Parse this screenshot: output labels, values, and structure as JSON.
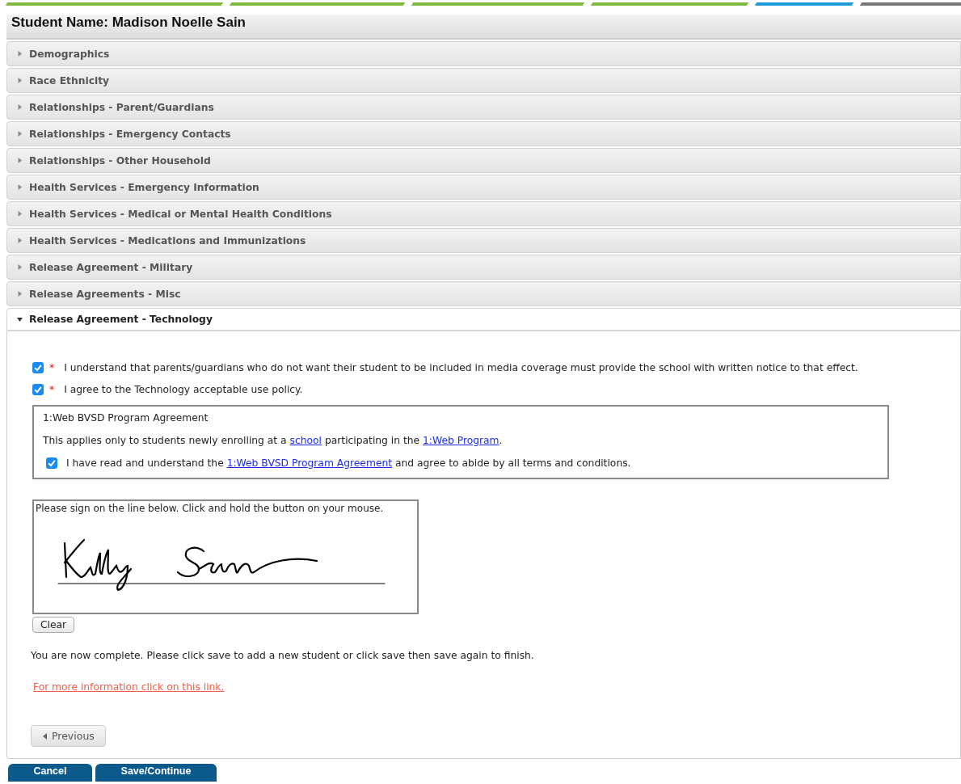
{
  "steps": [
    {
      "color": "#7dbb42"
    },
    {
      "color": "#7dbb42"
    },
    {
      "color": "#7dbb42"
    },
    {
      "color": "#7dbb42"
    },
    {
      "color": "#1e9ad6"
    },
    {
      "color": "#777777"
    }
  ],
  "title": "Student Name: Madison Noelle Sain",
  "sections": [
    {
      "title": "Demographics",
      "expanded": false
    },
    {
      "title": "Race Ethnicity",
      "expanded": false
    },
    {
      "title": "Relationships - Parent/Guardians",
      "expanded": false
    },
    {
      "title": "Relationships - Emergency Contacts",
      "expanded": false
    },
    {
      "title": "Relationships - Other Household",
      "expanded": false
    },
    {
      "title": "Health Services - Emergency Information",
      "expanded": false
    },
    {
      "title": "Health Services - Medical or Mental Health Conditions",
      "expanded": false
    },
    {
      "title": "Health Services - Medications and Immunizations",
      "expanded": false
    },
    {
      "title": "Release Agreement - Military",
      "expanded": false
    },
    {
      "title": "Release Agreements - Misc",
      "expanded": false
    },
    {
      "title": "Release Agreement - Technology",
      "expanded": true
    }
  ],
  "agreements": [
    {
      "checked": true,
      "required_mark": "*",
      "text": "I understand that parents/guardians who do not want their student to be included in media coverage must provide the school with written notice to that effect."
    },
    {
      "checked": true,
      "required_mark": "*",
      "text": "I agree to the Technology acceptable use policy."
    }
  ],
  "program_box": {
    "title": "1:Web BVSD Program Agreement",
    "note": [
      {
        "kind": "text",
        "text": "This applies only to students newly enrolling at a "
      },
      {
        "kind": "link",
        "text": "school"
      },
      {
        "kind": "text",
        "text": " participating in the "
      },
      {
        "kind": "link",
        "text": "1:Web Program"
      },
      {
        "kind": "text",
        "text": "."
      }
    ],
    "agreement": {
      "checked": true,
      "parts": [
        {
          "kind": "text",
          "text": "I have read and understand the "
        },
        {
          "kind": "link",
          "text": "1:Web BVSD Program Agreement"
        },
        {
          "kind": "text",
          "text": " and agree to abide by all terms and conditions."
        }
      ]
    }
  },
  "signature": {
    "prompt": "Please sign on the line below. Click and hold the button on your mouse.",
    "clear_button": "Clear"
  },
  "completion_text": "You are now complete. Please click save to add a new student or click save then save again to finish.",
  "info_link": "For more information click on this link.",
  "previous_button": "Previous",
  "footer_buttons": [
    "Cancel",
    "Save/Continue"
  ]
}
